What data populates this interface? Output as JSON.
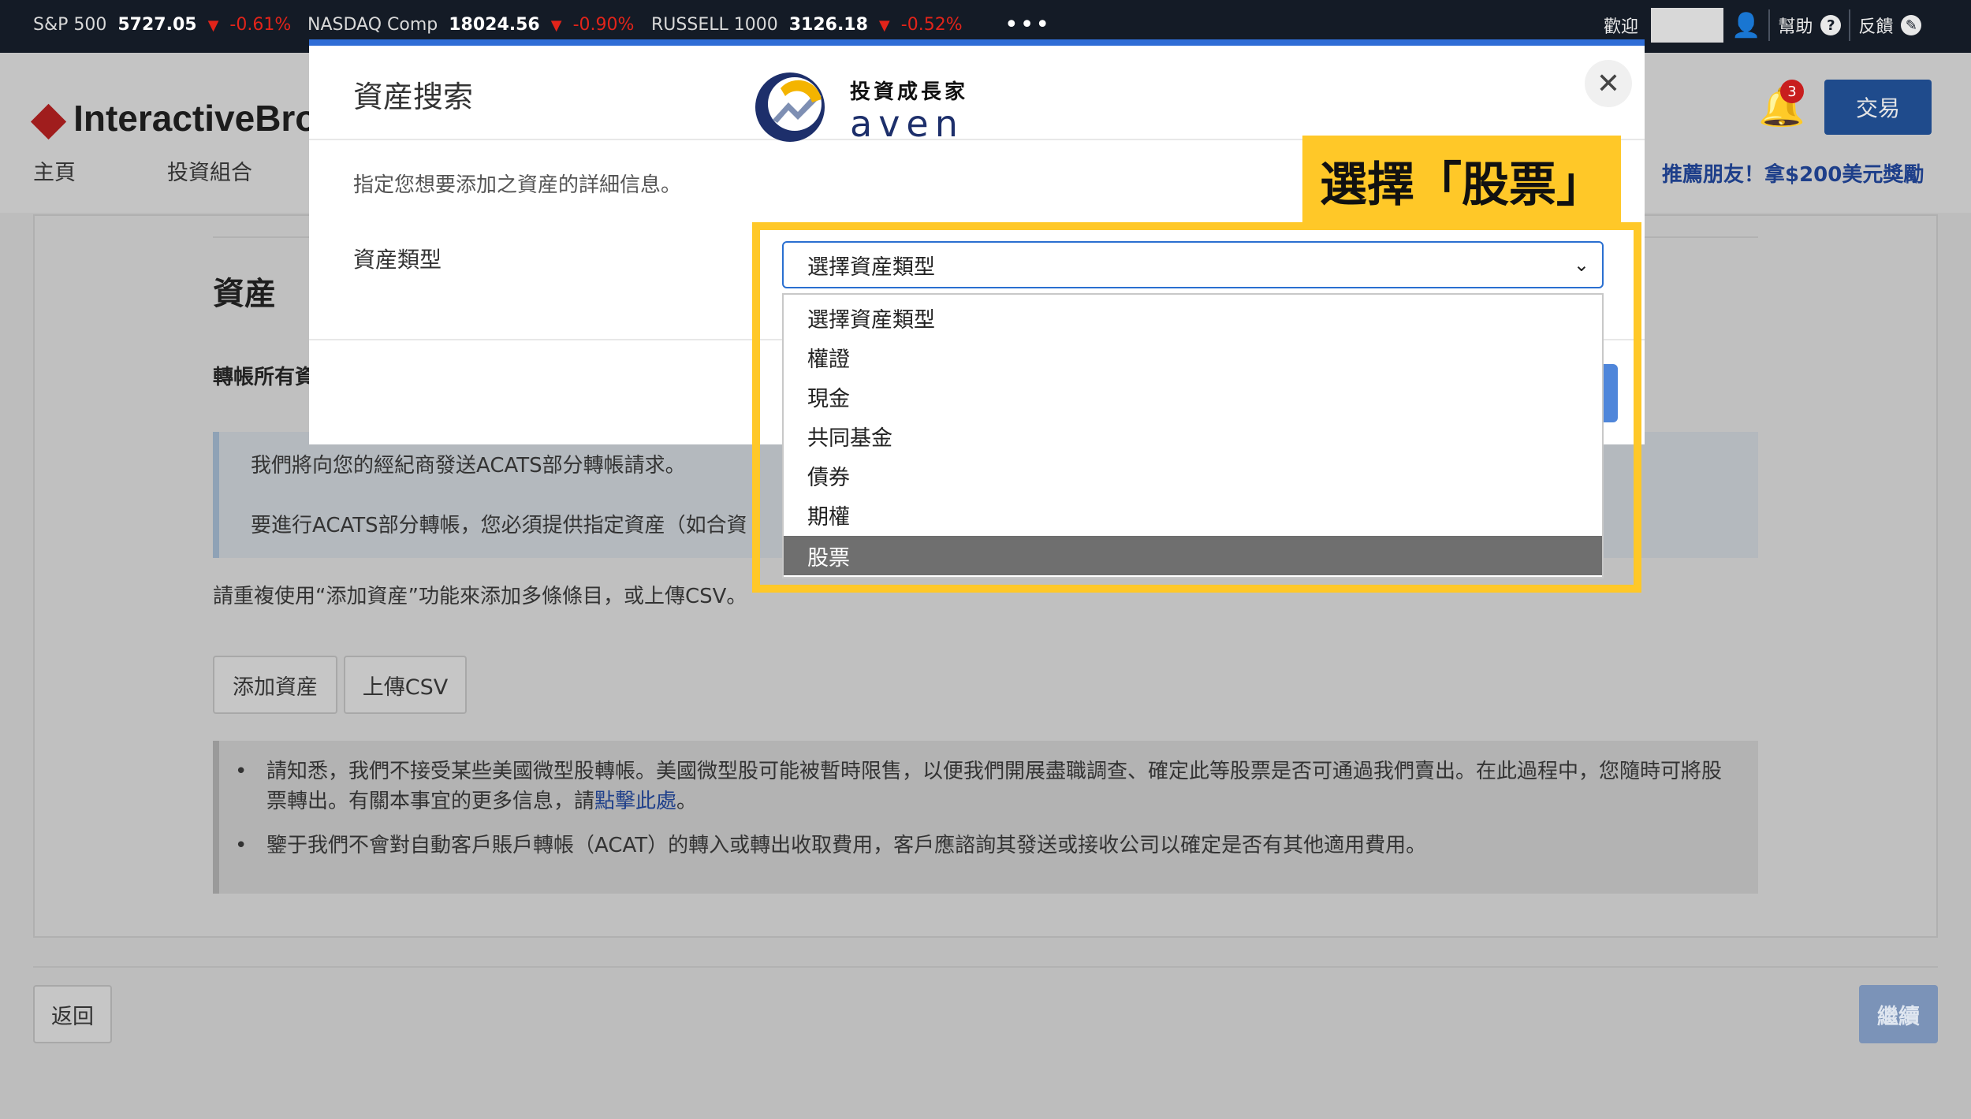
{
  "ticker": {
    "items": [
      {
        "name": "S&P 500",
        "value": "5727.05",
        "change": "-0.61%"
      },
      {
        "name": "NASDAQ Comp",
        "value": "18024.56",
        "change": "-0.90%"
      },
      {
        "name": "RUSSELL 1000",
        "value": "3126.18",
        "change": "-0.52%"
      }
    ],
    "more": "•••",
    "welcome": "歡迎",
    "help": "幫助",
    "feedback": "反饋"
  },
  "header": {
    "logo_text": "InteractiveBrok",
    "nav": [
      "主頁",
      "投資組合"
    ],
    "notifications": "3",
    "trade_button": "交易",
    "referral": "推薦朋友！拿$200美元獎勵"
  },
  "page": {
    "title": "資産",
    "transfer_label": "轉帳所有資",
    "info_line1": "我們將向您的經紀商發送ACATS部分轉帳請求。",
    "info_line2": "要進行ACATS部分轉帳，您必須提供指定資産（如合資",
    "repeat_text": "請重複使用“添加資産”功能來添加多條條目，或上傳CSV。",
    "add_asset_button": "添加資産",
    "upload_csv_button": "上傳CSV",
    "notice1_a": "請知悉，我們不接受某些美國微型股轉帳。美國微型股可能被暫時限售，以便我們開展盡職調查、確定此等股票是否可通過我們賣出。在此過程中，您隨時可將股票轉出。有關本事宜的更多信息，請",
    "notice1_link": "點擊此處",
    "notice1_end": "。",
    "notice2": "鑒于我們不會對自動客戶賬戶轉帳（ACAT）的轉入或轉出收取費用，客戶應諮詢其發送或接收公司以確定是否有其他適用費用。",
    "back_button": "返回",
    "continue_button": "繼續"
  },
  "modal": {
    "title": "資産搜索",
    "close": "✕",
    "description": "指定您想要添加之資産的詳細信息。",
    "asset_type_label": "資産類型",
    "select_value": "選擇資産類型",
    "options": [
      "選擇資産類型",
      "權證",
      "現金",
      "共同基金",
      "債券",
      "期權",
      "股票"
    ],
    "highlighted_option_index": 6
  },
  "brand": {
    "name_zh": "投資成長家",
    "name_en": "aven"
  },
  "annotation": {
    "callout": "選擇「股票」",
    "color": "#ffc828"
  }
}
